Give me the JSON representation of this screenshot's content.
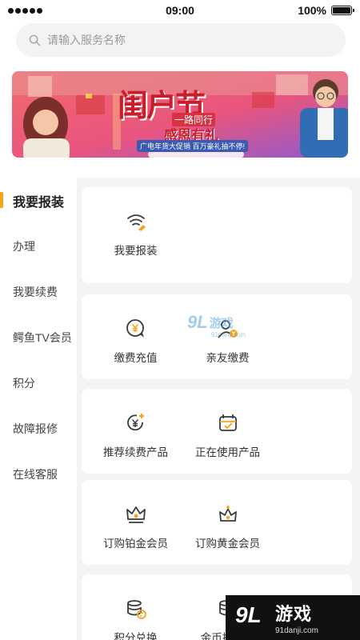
{
  "status_bar": {
    "time": "09:00",
    "battery": "100%",
    "battery_level": 1.0
  },
  "search": {
    "placeholder": "请输入服务名称"
  },
  "banner": {
    "title": "闺户节",
    "slogan_line1": "一路同行",
    "slogan_line2": "感恩有礼",
    "caption": "广电年货大促销 百万豪礼抽不停!"
  },
  "nav": {
    "items": [
      {
        "label": "我要报装",
        "active": true
      },
      {
        "label": "办理"
      },
      {
        "label": "我要续费"
      },
      {
        "label": "鳄鱼TV会员"
      },
      {
        "label": "积分"
      },
      {
        "label": "故障报修"
      },
      {
        "label": "在线客服"
      }
    ]
  },
  "cards": [
    {
      "items": [
        {
          "label": "我要报装",
          "icon": "wifi-wrench-icon"
        }
      ]
    },
    {
      "items": [
        {
          "label": "缴费充值",
          "icon": "yuan-chat-icon"
        },
        {
          "label": "亲友缴费",
          "icon": "user-yuan-icon"
        }
      ]
    },
    {
      "items": [
        {
          "label": "推荐续费产品",
          "icon": "yuan-plus-icon"
        },
        {
          "label": "正在使用产品",
          "icon": "checked-box-icon"
        }
      ]
    },
    {
      "items": [
        {
          "label": "订购铂金会员",
          "icon": "crown-icon"
        },
        {
          "label": "订购黄金会员",
          "icon": "crown-gem-icon"
        }
      ]
    },
    {
      "items": [
        {
          "label": "积分兑换",
          "icon": "coins-exchange-icon"
        },
        {
          "label": "金币换积分",
          "icon": "coins-yuan-icon"
        }
      ]
    }
  ],
  "watermark": {
    "brand": "游戏",
    "url": "91danji.com",
    "logo_text": "9L"
  },
  "colors": {
    "accent": "#f7a21b",
    "icon_dark": "#3a3a3a",
    "background": "#f4f4f4"
  }
}
